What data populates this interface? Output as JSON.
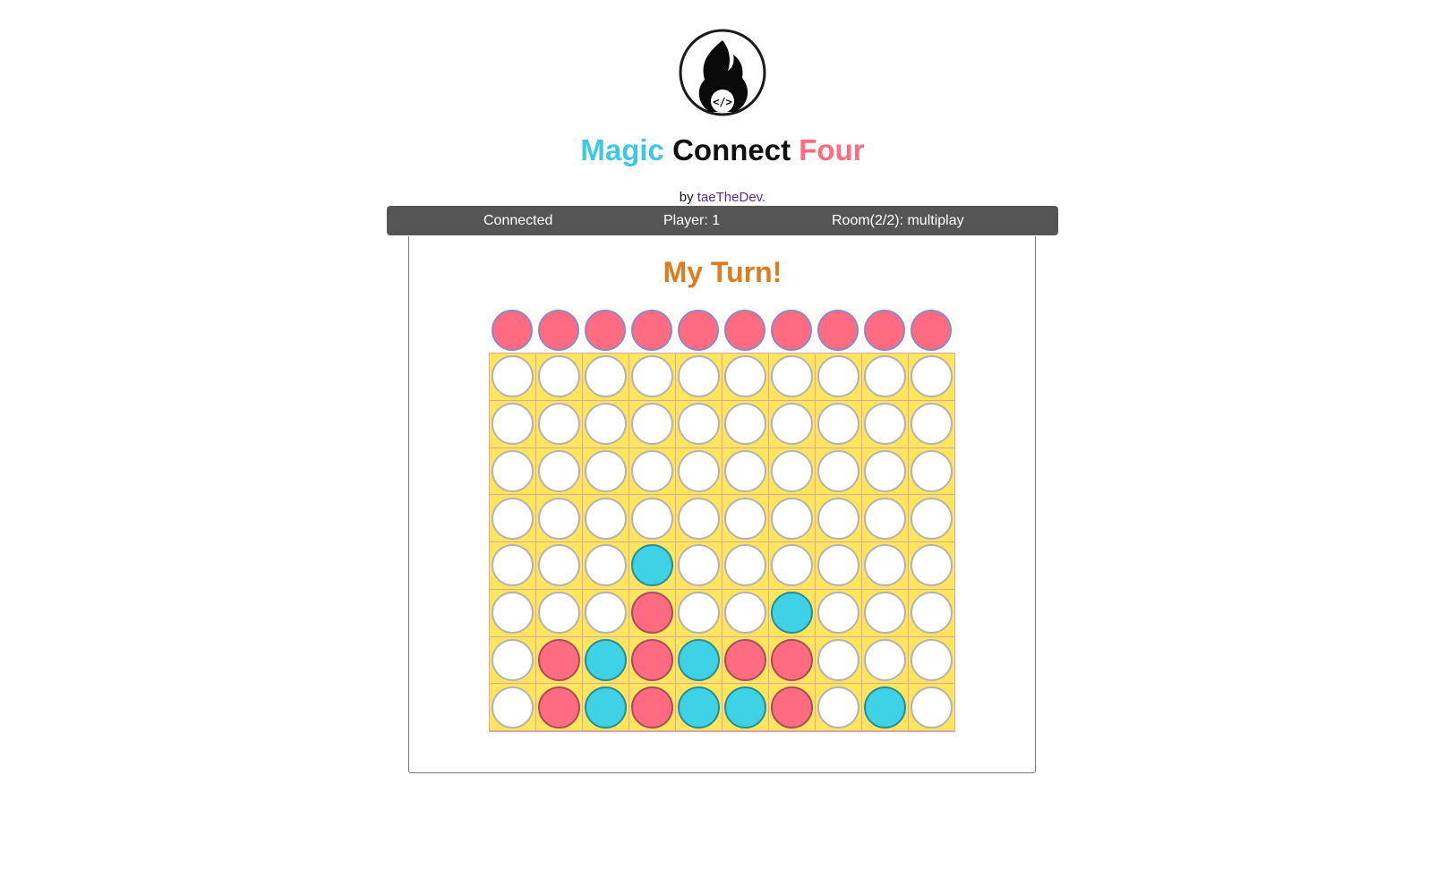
{
  "header": {
    "logo_icon": "flame-code-icon",
    "title_parts": [
      "Magic",
      "Connect",
      "Four"
    ],
    "title_colors": [
      "#3fc8e0",
      "#111111",
      "#ff6b81"
    ],
    "byline_prefix": "by",
    "author_link": "taeTheDev",
    "byline_suffix": "."
  },
  "status_bar": {
    "connection": "Connected",
    "player": "Player: 1",
    "room": "Room(2/2): multiplay"
  },
  "game": {
    "turn_message": "My Turn!",
    "turn_color": "#e07b1c",
    "current_player_piece": "red",
    "piece_colors": {
      "red": "#ff6b81",
      "blue": "#3fd1e6",
      "empty": "#ffffff"
    },
    "board": {
      "rows": 8,
      "cols": 10,
      "cells": [
        [
          "empty",
          "empty",
          "empty",
          "empty",
          "empty",
          "empty",
          "empty",
          "empty",
          "empty",
          "empty"
        ],
        [
          "empty",
          "empty",
          "empty",
          "empty",
          "empty",
          "empty",
          "empty",
          "empty",
          "empty",
          "empty"
        ],
        [
          "empty",
          "empty",
          "empty",
          "empty",
          "empty",
          "empty",
          "empty",
          "empty",
          "empty",
          "empty"
        ],
        [
          "empty",
          "empty",
          "empty",
          "empty",
          "empty",
          "empty",
          "empty",
          "empty",
          "empty",
          "empty"
        ],
        [
          "empty",
          "empty",
          "empty",
          "blue",
          "empty",
          "empty",
          "empty",
          "empty",
          "empty",
          "empty"
        ],
        [
          "empty",
          "empty",
          "empty",
          "red",
          "empty",
          "empty",
          "blue",
          "empty",
          "empty",
          "empty"
        ],
        [
          "empty",
          "red",
          "blue",
          "red",
          "blue",
          "red",
          "red",
          "empty",
          "empty",
          "empty"
        ],
        [
          "empty",
          "red",
          "blue",
          "red",
          "blue",
          "blue",
          "red",
          "empty",
          "blue",
          "empty"
        ]
      ]
    }
  }
}
